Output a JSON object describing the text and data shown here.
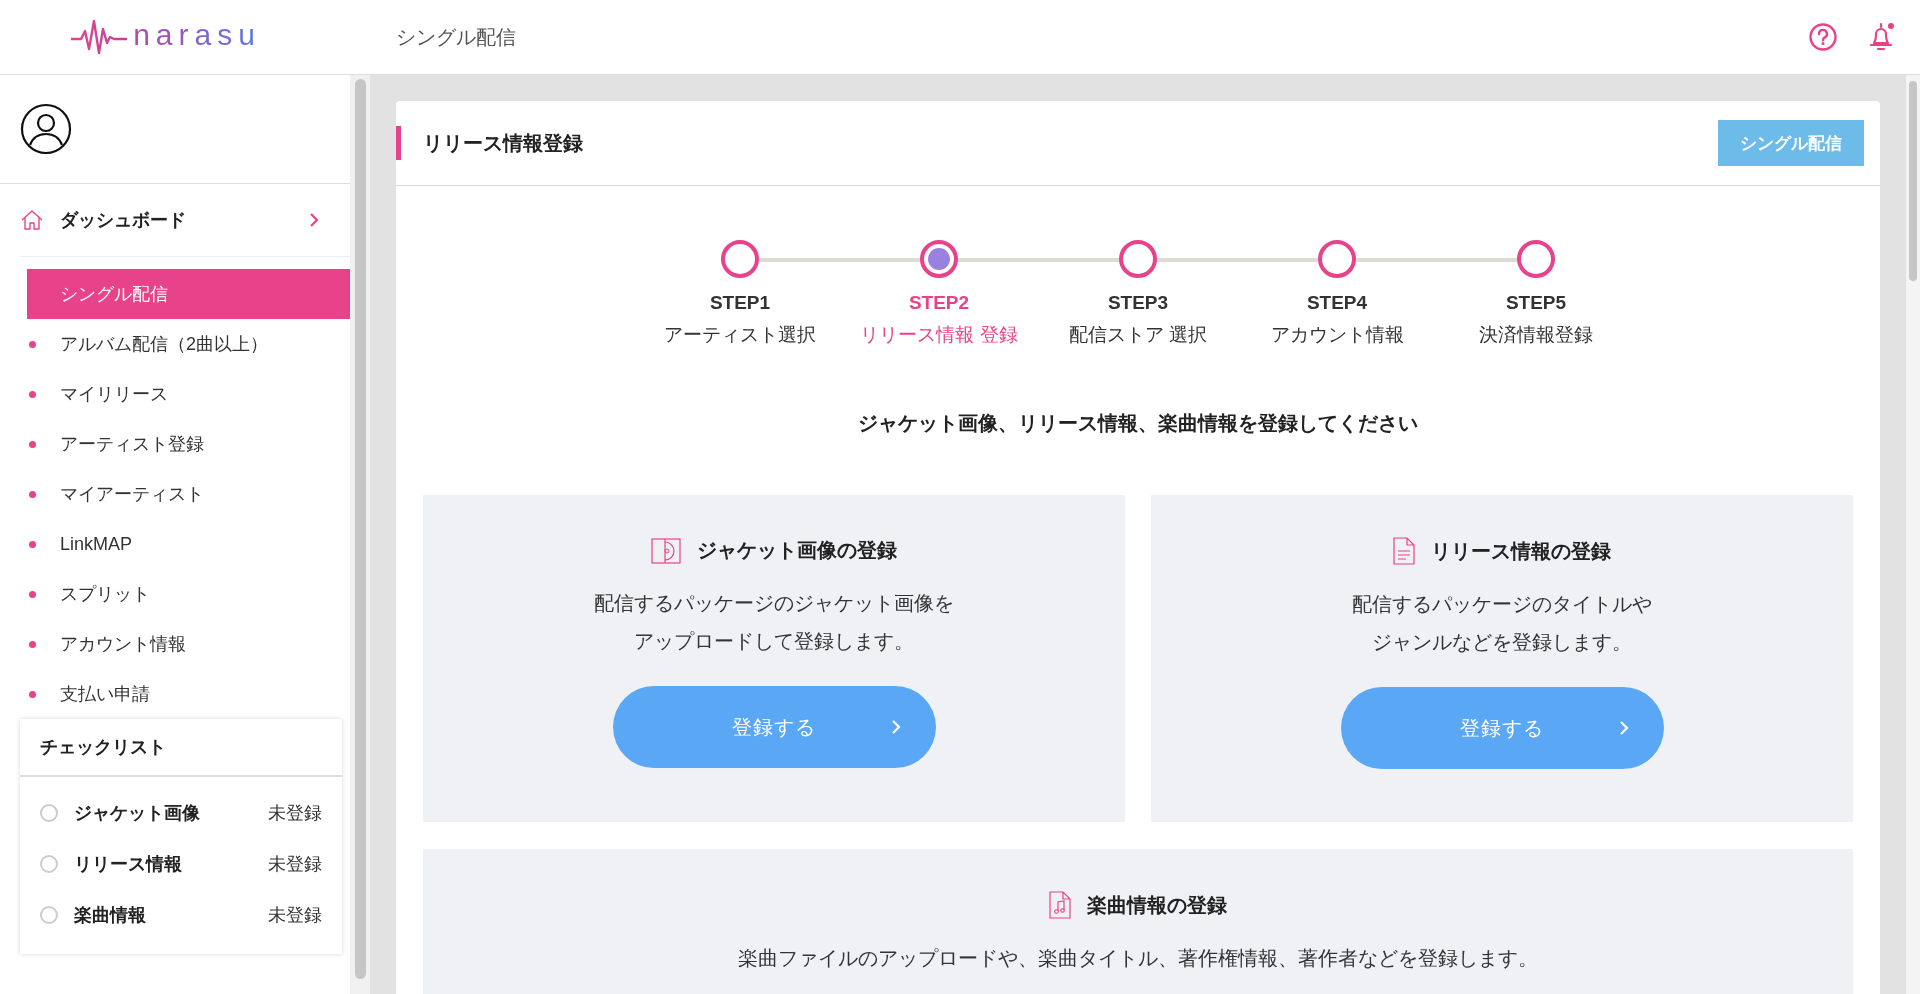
{
  "header": {
    "logo": "narasu",
    "page_title": "シングル配信"
  },
  "sidebar": {
    "dashboard": "ダッシュボード",
    "items": [
      {
        "label": "シングル配信",
        "selected": true
      },
      {
        "label": "アルバム配信（2曲以上）",
        "selected": false
      },
      {
        "label": "マイリリース",
        "selected": false
      },
      {
        "label": "アーティスト登録",
        "selected": false
      },
      {
        "label": "マイアーティスト",
        "selected": false
      },
      {
        "label": "LinkMAP",
        "selected": false
      },
      {
        "label": "スプリット",
        "selected": false
      },
      {
        "label": "アカウント情報",
        "selected": false
      },
      {
        "label": "支払い申請",
        "selected": false
      }
    ],
    "checklist": {
      "title": "チェックリスト",
      "items": [
        {
          "label": "ジャケット画像",
          "status": "未登録",
          "checked": false
        },
        {
          "label": "リリース情報",
          "status": "未登録",
          "checked": false
        },
        {
          "label": "楽曲情報",
          "status": "未登録",
          "checked": false
        }
      ]
    }
  },
  "main": {
    "title": "リリース情報登録",
    "header_button": "シングル配信",
    "steps": [
      {
        "step": "STEP1",
        "label": "アーティスト選択",
        "selected": false
      },
      {
        "step": "STEP2",
        "label": "リリース情報 登録",
        "selected": true
      },
      {
        "step": "STEP3",
        "label": "配信ストア 選択",
        "selected": false
      },
      {
        "step": "STEP4",
        "label": "アカウント情報",
        "selected": false
      },
      {
        "step": "STEP5",
        "label": "決済情報登録",
        "selected": false
      }
    ],
    "instruction": "ジャケット画像、リリース情報、楽曲情報を登録してください",
    "cards": [
      {
        "kind": "jacket",
        "title": "ジャケット画像の登録",
        "lines": [
          "配信するパッケージのジャケット画像を",
          "アップロードして登録します。"
        ],
        "button": "登録する"
      },
      {
        "kind": "document",
        "title": "リリース情報の登録",
        "lines": [
          "配信するパッケージのタイトルや",
          "ジャンルなどを登録します。"
        ],
        "button": "登録する"
      },
      {
        "kind": "music",
        "title": "楽曲情報の登録",
        "lines": [
          "楽曲ファイルのアップロードや、楽曲タイトル、著作権情報、著作者などを登録します。"
        ]
      }
    ]
  }
}
